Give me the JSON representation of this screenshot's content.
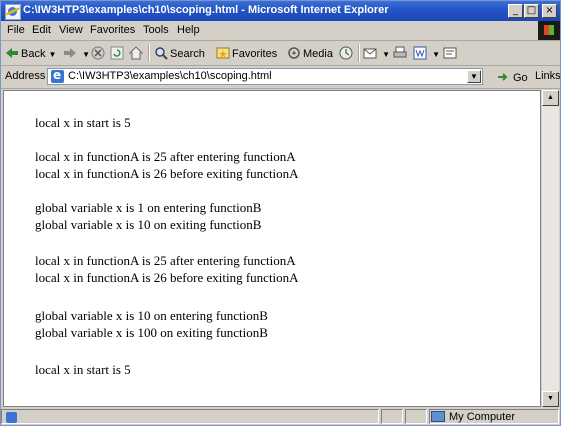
{
  "window": {
    "title": "C:\\IW3HTP3\\examples\\ch10\\scoping.html - Microsoft Internet Explorer",
    "minimize": "_",
    "restore": "□",
    "close": "×"
  },
  "menu": [
    "File",
    "Edit",
    "View",
    "Favorites",
    "Tools",
    "Help"
  ],
  "toolbar": {
    "back": "Back",
    "search": "Search",
    "favorites": "Favorites",
    "media": "Media"
  },
  "address": {
    "label": "Address",
    "value": "C:\\IW3HTP3\\examples\\ch10\\scoping.html",
    "go": "Go",
    "links": "Links"
  },
  "content": {
    "paragraphs": [
      [
        "local x in start is 5"
      ],
      [
        "local x in functionA is 25 after entering functionA",
        "local x in functionA is 26 before exiting functionA"
      ],
      [
        "global variable x is 1 on entering functionB",
        "global variable x is 10 on exiting functionB"
      ],
      [
        "local x in functionA is 25 after entering functionA",
        "local x in functionA is 26 before exiting functionA"
      ],
      [
        "global variable x is 10 on entering functionB",
        "global variable x is 100 on exiting functionB"
      ],
      [
        "local x in start is 5"
      ]
    ]
  },
  "status": {
    "zone": "My Computer"
  }
}
